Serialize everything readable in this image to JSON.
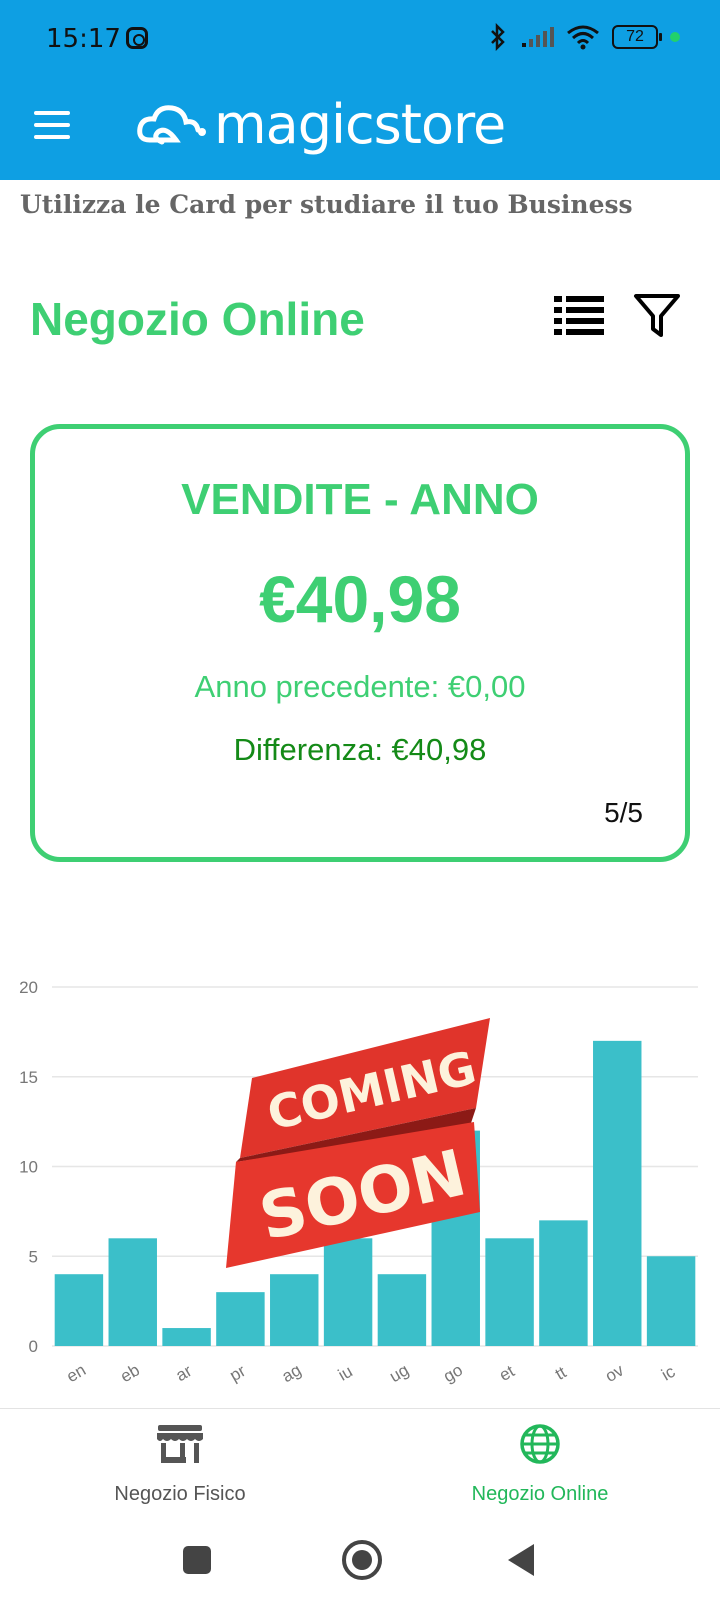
{
  "status_bar": {
    "time": "15:17",
    "battery": "72"
  },
  "app_bar": {
    "logo_text": "magicstore"
  },
  "subtitle": "Utilizza le Card per studiare il tuo Business",
  "section": {
    "title": "Negozio Online"
  },
  "card": {
    "title": "VENDITE - ANNO",
    "value": "€40,98",
    "previous": "Anno precedente: €0,00",
    "difference": "Differenza: €40,98",
    "pager": "5/5"
  },
  "overlay": {
    "line1": "COMING",
    "line2": "SOON"
  },
  "chart_data": {
    "type": "bar",
    "categories": [
      "en",
      "eb",
      "ar",
      "pr",
      "ag",
      "iu",
      "ug",
      "go",
      "et",
      "tt",
      "ov",
      "ic"
    ],
    "values": [
      4,
      6,
      1,
      3,
      4,
      6,
      4,
      12,
      6,
      7,
      17,
      5
    ],
    "yticks": [
      "0",
      "5",
      "10",
      "15",
      "20"
    ],
    "ylim": [
      0,
      20
    ],
    "grid": true,
    "color": "#3bbfc9"
  },
  "bottom_nav": {
    "items": [
      {
        "label": "Negozio Fisico",
        "icon": "store-icon",
        "active": false
      },
      {
        "label": "Negozio Online",
        "icon": "globe-icon",
        "active": true
      }
    ]
  },
  "colors": {
    "primary": "#0e9fe3",
    "accent_green": "#3ecf73",
    "dark_green": "#148a17",
    "bar": "#3bbfc9"
  }
}
